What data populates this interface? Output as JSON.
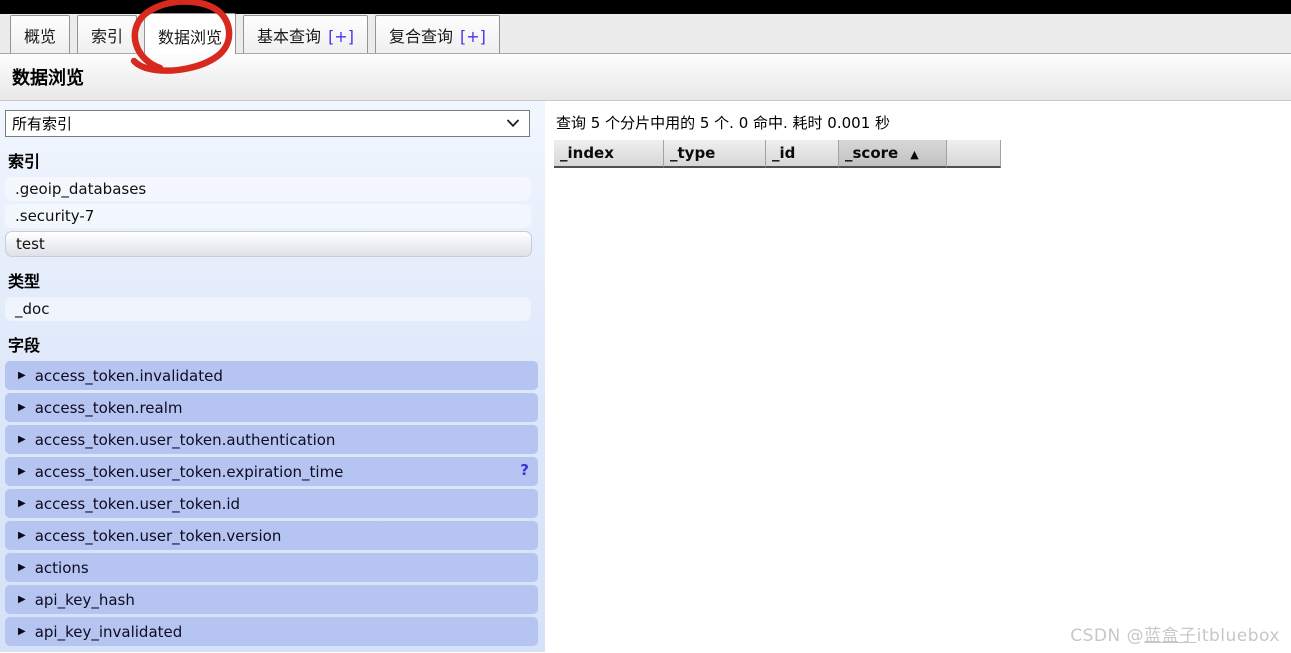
{
  "tabs": [
    {
      "label": "概览",
      "suffix": ""
    },
    {
      "label": "索引",
      "suffix": ""
    },
    {
      "label": "数据浏览",
      "suffix": ""
    },
    {
      "label": "基本查询",
      "suffix": "[+]"
    },
    {
      "label": "复合查询",
      "suffix": "[+]"
    }
  ],
  "active_tab": "数据浏览",
  "page_title": "数据浏览",
  "sidebar": {
    "index_select_value": "所有索引",
    "section_index": "索引",
    "section_type": "类型",
    "section_fields": "字段",
    "indices": [
      ".geoip_databases",
      ".security-7",
      "test"
    ],
    "selected_index": "test",
    "types": [
      "_doc"
    ],
    "fields": [
      "access_token.invalidated",
      "access_token.realm",
      "access_token.user_token.authentication",
      "access_token.user_token.expiration_time",
      "access_token.user_token.id",
      "access_token.user_token.version",
      "actions",
      "api_key_hash",
      "api_key_invalidated"
    ],
    "field_help": "?",
    "expand_icon": "▶"
  },
  "results": {
    "summary": "查询 5 个分片中用的 5 个. 0 命中. 耗时 0.001 秒",
    "columns": [
      "_index",
      "_type",
      "_id",
      "_score"
    ],
    "sort_column": "_score",
    "sort_indicator": "▲"
  },
  "watermark": {
    "prefix": "CSDN @",
    "user": "蓝盒子",
    "suffix": "itbluebox"
  },
  "colors": {
    "plus_accent": "#4634f0",
    "field_row_bg": "#b5c4f1",
    "sidebar_bg": "#dde7fa",
    "annotation_red": "#d7291d",
    "help_icon_color": "#3a35d8"
  }
}
